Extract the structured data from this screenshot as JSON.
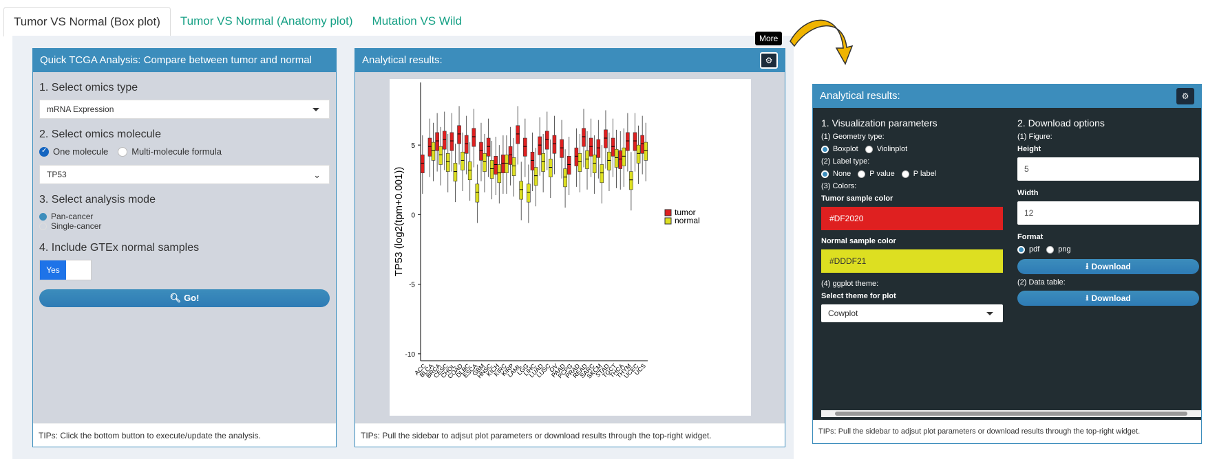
{
  "tabs": [
    {
      "label": "Tumor VS Normal (Box plot)",
      "active": true
    },
    {
      "label": "Tumor VS Normal (Anatomy plot)"
    },
    {
      "label": "Mutation VS Wild"
    }
  ],
  "left": {
    "title": "Quick TCGA Analysis: Compare between tumor and normal",
    "s1": "1. Select omics type",
    "omics_type": "mRNA Expression",
    "s2": "2. Select omics molecule",
    "mol_opt1": "One molecule",
    "mol_opt2": "Multi-molecule formula",
    "molecule": "TP53",
    "s3": "3. Select analysis mode",
    "mode1": "Pan-cancer",
    "mode2": "Single-cancer",
    "s4": "4. Include GTEx normal samples",
    "toggle": "Yes",
    "go": "Go!",
    "tip": "TIPs: Click the bottom button to execute/update the analysis."
  },
  "mid": {
    "title": "Analytical results:",
    "tooltip": "More",
    "tip": "TIPs: Pull the sidebar to adjsut plot parameters or download results through the top-right widget."
  },
  "right": {
    "title": "Analytical results:",
    "vis": "1. Visualization parameters",
    "geom": "(1) Geometry type:",
    "g1": "Boxplot",
    "g2": "Violinplot",
    "ltype": "(2) Label type:",
    "l1": "None",
    "l2": "P value",
    "l3": "P label",
    "colors": "(3) Colors:",
    "tumor_lbl": "Tumor sample color",
    "tumor_color": "#DF2020",
    "normal_lbl": "Normal sample color",
    "normal_color": "#DDDF21",
    "theme": "(4) ggplot theme:",
    "theme_lbl": "Select theme for plot",
    "theme_val": "Cowplot",
    "dl": "2. Download options",
    "fig": "(1) Figure:",
    "h_lbl": "Height",
    "h": "5",
    "w_lbl": "Width",
    "w": "12",
    "fmt": "Format",
    "f1": "pdf",
    "f2": "png",
    "download": "Download",
    "dt": "(2) Data table:",
    "tip": "TIPs: Pull the sidebar to adjsut plot parameters or download results through the top-right widget."
  },
  "chart_data": {
    "type": "box",
    "ylabel": "TP53 (log2(tpm+0.001))",
    "yticks": [
      5,
      0,
      -5,
      -10
    ],
    "ylim": [
      -10.5,
      9.5
    ],
    "legend": [
      {
        "name": "tumor",
        "color": "#DF2020"
      },
      {
        "name": "normal",
        "color": "#DDDF21"
      }
    ],
    "legend_position": "right",
    "categories": [
      "ACC",
      "BLCA",
      "BRCA",
      "CESC",
      "CHOL",
      "COAD",
      "DLBC",
      "ESCA",
      "GBM",
      "HNSC",
      "KICH",
      "KIRC",
      "KIRP",
      "LAML",
      "LGG",
      "LIHC",
      "LUAD",
      "LUSC",
      "OV",
      "PAAD",
      "PCPG",
      "PRAD",
      "READ",
      "SARC",
      "SKCM",
      "STAD",
      "TGCT",
      "THCA",
      "THYM",
      "UCEC",
      "UCS"
    ],
    "tumor_median": [
      3.7,
      4.9,
      5.3,
      5.4,
      5.3,
      5.8,
      5.1,
      5.6,
      4.6,
      4.9,
      3.6,
      3.7,
      4.3,
      5.8,
      4.9,
      3.9,
      5.0,
      5.4,
      5.1,
      4.8,
      3.6,
      4.2,
      5.6,
      4.9,
      4.8,
      5.5,
      4.9,
      4.0,
      5.3,
      5.3,
      5.1
    ],
    "normal_median": [
      null,
      4.6,
      4.3,
      3.8,
      3.1,
      3.9,
      3.2,
      1.6,
      3.8,
      3.3,
      3.0,
      3.7,
      3.5,
      1.8,
      1.6,
      2.8,
      3.8,
      3.4,
      null,
      2.7,
      null,
      3.8,
      4.0,
      3.7,
      3.0,
      3.9,
      4.1,
      4.2,
      2.5,
      4.4,
      4.6
    ]
  }
}
